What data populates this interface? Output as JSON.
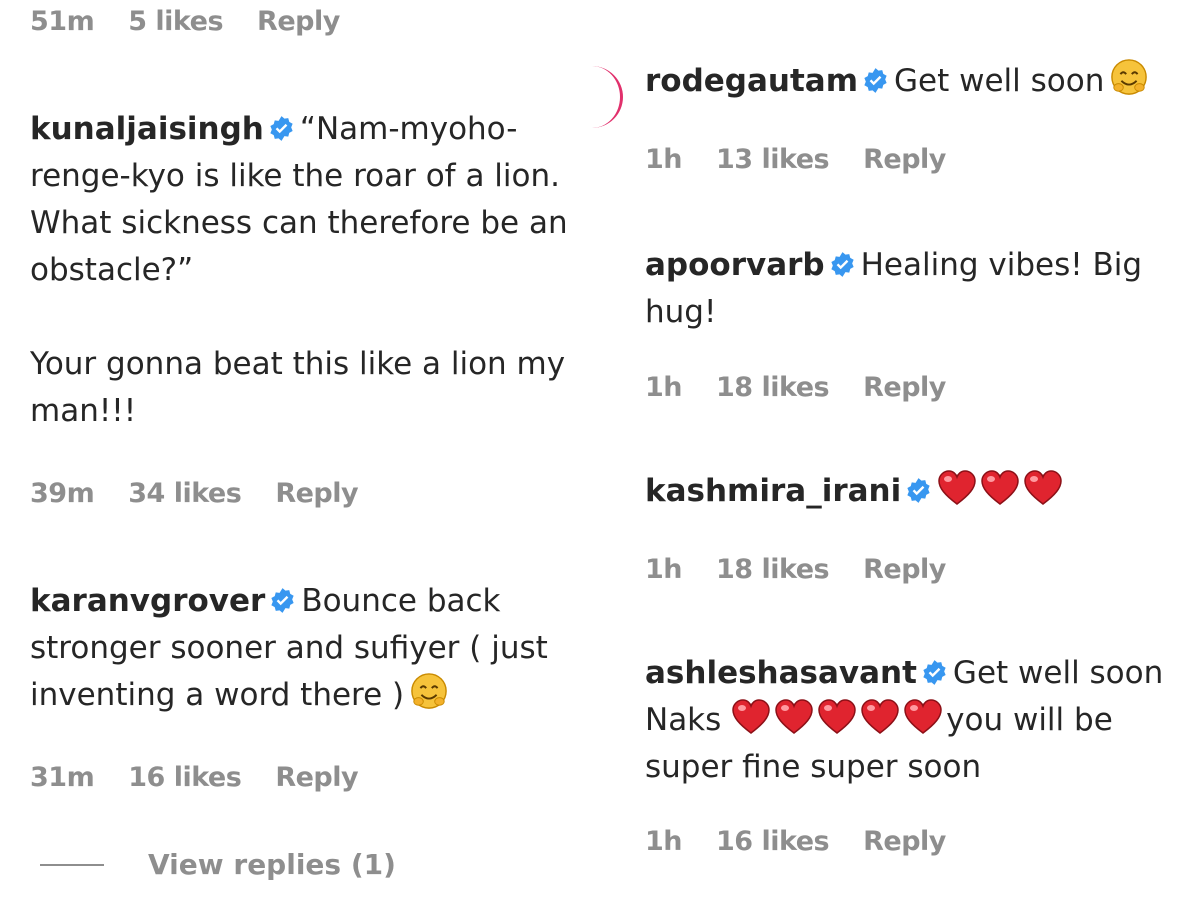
{
  "left_column": {
    "top_meta": {
      "time": "51m",
      "likes": "5 likes",
      "reply": "Reply"
    },
    "comments": [
      {
        "username": "kunaljaisingh",
        "text": "“Nam-myoho-renge-kyo is like the roar of a lion. What sickness can therefore be an obstacle?”\n\nYour gonna beat this like a lion my man!!!",
        "time": "39m",
        "likes": "34 likes",
        "reply": "Reply"
      },
      {
        "username": "karanvgrover",
        "text": "Bounce back stronger sooner and sufiyer ( just inventing a word there )",
        "emoji": "smiling-face-icon",
        "time": "31m",
        "likes": "16 likes",
        "reply": "Reply"
      }
    ],
    "view_replies": "View replies (1)"
  },
  "right_column": {
    "comments": [
      {
        "username": "rodegautam",
        "text": "Get well soon",
        "emoji": "smiling-face-icon",
        "time": "1h",
        "likes": "13 likes",
        "reply": "Reply"
      },
      {
        "username": "apoorvarb",
        "text": "Healing vibes! Big hug!",
        "time": "1h",
        "likes": "18 likes",
        "reply": "Reply"
      },
      {
        "username": "kashmira_irani",
        "hearts": 3,
        "time": "1h",
        "likes": "18 likes",
        "reply": "Reply"
      },
      {
        "username": "ashleshasavant",
        "text_before": "Get well soon Naks",
        "hearts": 5,
        "text_after": "you will be super fine super soon",
        "time": "1h",
        "likes": "16 likes",
        "reply": "Reply"
      }
    ]
  },
  "colors": {
    "text": "#262626",
    "meta": "#8e8e8e",
    "verified": "#3897f0",
    "heart": "#e0242f",
    "emoji": "#f6c33b"
  }
}
